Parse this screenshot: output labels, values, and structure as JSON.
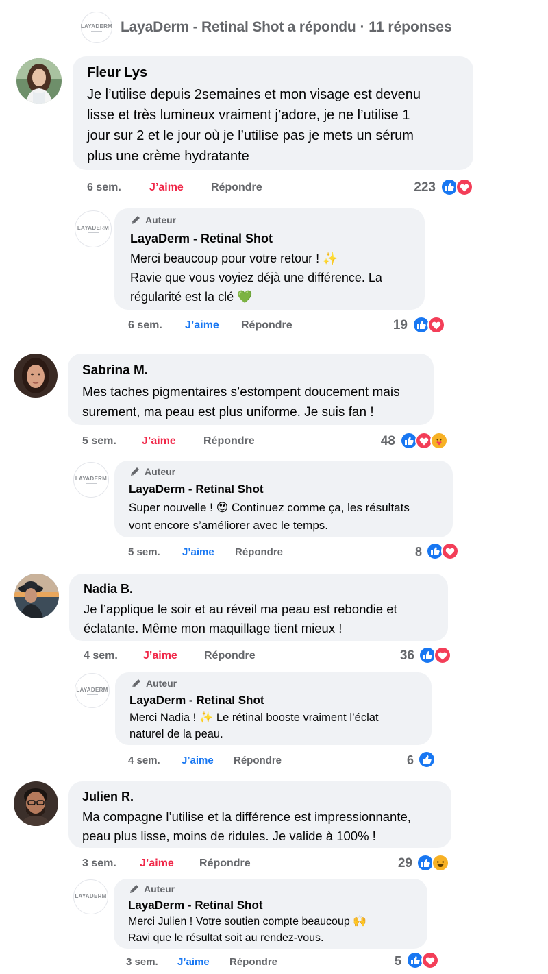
{
  "header": {
    "title": "LayaDerm - Retinal Shot a répondu",
    "count": "· 11 réponses",
    "logo_text": "LAYADERM"
  },
  "comments": [
    {
      "name": "Fleur Lys",
      "text": "Je l’utilise depuis 2semaines et mon visage est devenu\nlisse et très lumineux vraiment j’adore, je ne l’utilise 1\njour sur 2 et le jour où je l’utilise pas je mets un sérum\nplus une crème hydratante",
      "time": "6 sem.",
      "like": "J’aime",
      "reply": "Répondre",
      "reactions_count": "223",
      "reaction_icons": [
        "like-icon",
        "love-icon"
      ],
      "author_reply": {
        "badge": "Auteur",
        "name": "LayaDerm - Retinal Shot",
        "text": "Merci beaucoup pour votre retour ! ✨\nRavie que vous voyiez déjà une différence. La\nrégularité est la clé 💚",
        "time": "6 sem.",
        "like": "J’aime",
        "reply": "Répondre",
        "reactions_count": "19",
        "reaction_icons": [
          "like-icon",
          "love-icon"
        ]
      }
    },
    {
      "name": "Sabrina M.",
      "text": "Mes taches pigmentaires s’estompent doucement mais\nsurement, ma peau est plus uniforme. Je suis fan !",
      "time": "5 sem.",
      "like": "J’aime",
      "reply": "Répondre",
      "reactions_count": "48",
      "reaction_icons": [
        "like-icon",
        "love-icon",
        "care-icon"
      ],
      "author_reply": {
        "badge": "Auteur",
        "name": "LayaDerm - Retinal Shot",
        "text": "Super nouvelle ! 😍 Continuez comme ça, les résultats\nvont encore s’améliorer avec le temps.",
        "time": "5 sem.",
        "like": "J’aime",
        "reply": "Répondre",
        "reactions_count": "8",
        "reaction_icons": [
          "like-icon",
          "love-icon"
        ]
      }
    },
    {
      "name": "Nadia B.",
      "text": "Je l’applique le soir et au réveil ma peau est rebondie et\néclatante. Même mon maquillage tient mieux !",
      "time": "4 sem.",
      "like": "J’aime",
      "reply": "Répondre",
      "reactions_count": "36",
      "reaction_icons": [
        "like-icon",
        "love-icon"
      ],
      "author_reply": {
        "badge": "Auteur",
        "name": "LayaDerm - Retinal Shot",
        "text": "Merci Nadia ! ✨ Le rétinal booste vraiment l’éclat\nnaturel de la peau.",
        "time": "4 sem.",
        "like": "J’aime",
        "reply": "Répondre",
        "reactions_count": "6",
        "reaction_icons": [
          "like-icon"
        ]
      }
    },
    {
      "name": "Julien R.",
      "text": "Ma compagne l’utilise et la différence est impressionnante,\npeau plus lisse, moins de ridules. Je valide à 100% !",
      "time": "3 sem.",
      "like": "J’aime",
      "reply": "Répondre",
      "reactions_count": "29",
      "reaction_icons": [
        "like-icon",
        "haha-icon"
      ],
      "author_reply": {
        "badge": "Auteur",
        "name": "LayaDerm - Retinal Shot",
        "text": "Merci Julien ! Votre soutien compte beaucoup 🙌\nRavi que le résultat soit au rendez-vous.",
        "time": "3 sem.",
        "like": "J’aime",
        "reply": "Répondre",
        "reactions_count": "5",
        "reaction_icons": [
          "like-icon",
          "love-icon"
        ]
      }
    }
  ],
  "colors": {
    "like_red": "#f02849",
    "like_blue": "#1877f2",
    "bubble": "#f0f2f5",
    "muted": "#65676b"
  }
}
